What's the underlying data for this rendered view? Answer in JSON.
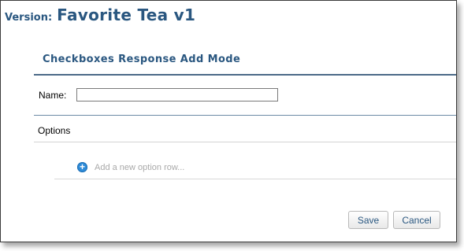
{
  "header": {
    "version_label": "Version:",
    "version_title": "Favorite Tea v1"
  },
  "panel": {
    "title": "Checkboxes Response Add Mode"
  },
  "form": {
    "name_label": "Name:",
    "name_value": "",
    "options_label": "Options",
    "add_option_text": "Add a new option row..."
  },
  "icons": {
    "add_option": "plus-circle-icon"
  },
  "buttons": {
    "save_label": "Save",
    "cancel_label": "Cancel"
  },
  "colors": {
    "accent": "#2a5780",
    "add_icon": "#2e8bd8"
  }
}
